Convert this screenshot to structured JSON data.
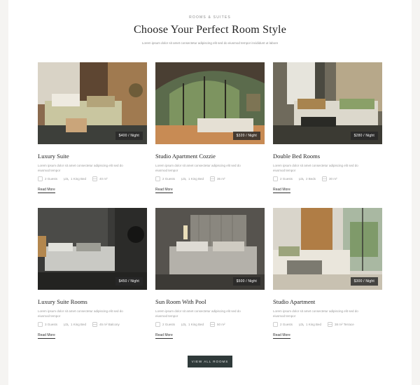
{
  "header": {
    "eyebrow": "rooms & suites",
    "title": "Choose Your Perfect Room Style",
    "subtitle": "Lorem ipsum dolor sit amet consectetur adipiscing elit sed do eiusmod tempor incididunt ut labore"
  },
  "rooms": [
    {
      "title": "Luxury Suite",
      "price": "$400 / Night",
      "desc": "Lorem ipsum dolor sit amet consectetur adipiscing elit sed do eiusmod tempor",
      "meta": [
        "2 Guests",
        "1 King Bed",
        "40 m²"
      ],
      "more": "Read More"
    },
    {
      "title": "Studio Apartment Cozzie",
      "price": "$320 / Night",
      "desc": "Lorem ipsum dolor sit amet consectetur adipiscing elit sed do eiusmod tempor",
      "meta": [
        "2 Guests",
        "1 King Bed",
        "35 m²"
      ],
      "more": "Read More"
    },
    {
      "title": "Double Bed Rooms",
      "price": "$280 / Night",
      "desc": "Lorem ipsum dolor sit amet consectetur adipiscing elit sed do eiusmod tempor",
      "meta": [
        "2 Guests",
        "2 Beds",
        "30 m²"
      ],
      "more": "Read More"
    },
    {
      "title": "Luxury Suite Rooms",
      "price": "$450 / Night",
      "desc": "Lorem ipsum dolor sit amet consectetur adipiscing elit sed do eiusmod tempor",
      "meta": [
        "3 Guests",
        "1 King Bed",
        "45 m² Balcony"
      ],
      "more": "Read More"
    },
    {
      "title": "Sun Room With Pool",
      "price": "$500 / Night",
      "desc": "Lorem ipsum dolor sit amet consectetur adipiscing elit sed do eiusmod tempor",
      "meta": [
        "2 Guests",
        "1 King Bed",
        "50 m²"
      ],
      "more": "Read More"
    },
    {
      "title": "Studio Apartment",
      "price": "$300 / Night",
      "desc": "Lorem ipsum dolor sit amet consectetur adipiscing elit sed do eiusmod tempor",
      "meta": [
        "2 Guests",
        "1 King Bed",
        "38 m² Terrace"
      ],
      "more": "Read More"
    }
  ],
  "button": {
    "label": "View All Rooms"
  }
}
